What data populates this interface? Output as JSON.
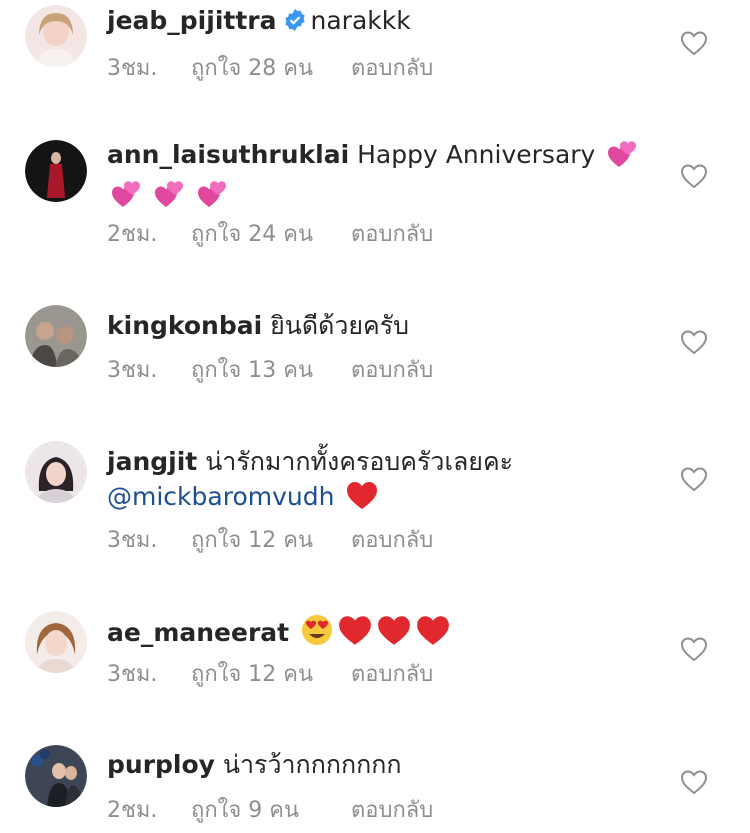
{
  "comments": [
    {
      "username": "jeab_pijittra",
      "verified": true,
      "text": "narakkk",
      "time": "3ชม.",
      "likes": "ถูกใจ 28 คน",
      "reply": "ตอบกลับ"
    },
    {
      "username": "ann_laisuthruklai",
      "text": "Happy Anniversary",
      "emoji": [
        "sparkling-heart",
        "sparkling-heart",
        "sparkling-heart",
        "sparkling-heart"
      ],
      "time": "2ชม.",
      "likes": "ถูกใจ 24 คน",
      "reply": "ตอบกลับ"
    },
    {
      "username": "kingkonbai",
      "text": "ยินดีด้วยครับ",
      "time": "3ชม.",
      "likes": "ถูกใจ 13 คน",
      "reply": "ตอบกลับ"
    },
    {
      "username": "jangjit",
      "text": "น่ารักมากทั้งครอบครัวเลยคะ",
      "mention": "@mickbaromvudh",
      "emoji": [
        "red-heart"
      ],
      "time": "3ชม.",
      "likes": "ถูกใจ 12 คน",
      "reply": "ตอบกลับ"
    },
    {
      "username": "ae_maneerat",
      "text": "",
      "emoji": [
        "heart-eyes",
        "red-heart",
        "red-heart",
        "red-heart"
      ],
      "time": "3ชม.",
      "likes": "ถูกใจ 12 คน",
      "reply": "ตอบกลับ"
    },
    {
      "username": "purploy",
      "text": "น่ารว้ากกกกกกก",
      "time": "2ชม.",
      "likes": "ถูกใจ 9 คน",
      "reply": "ตอบกลับ"
    }
  ],
  "colors": {
    "text": "#262626",
    "meta": "#8e8e8e",
    "mention": "#1d4f8c",
    "verified": "#3897f0",
    "heart_outline": "#8e8e8e"
  }
}
